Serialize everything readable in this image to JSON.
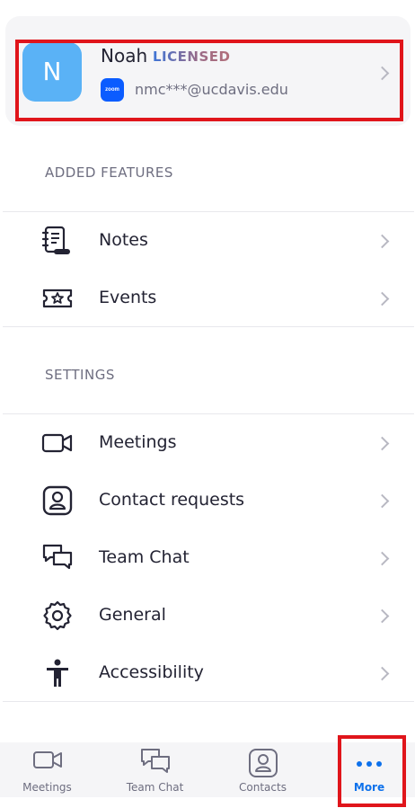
{
  "profile": {
    "avatar_initial": "N",
    "name": "Noah",
    "license": "LICENSED",
    "badge_text": "zoom",
    "email": "nmc***@ucdavis.edu"
  },
  "sections": {
    "added_features": "ADDED FEATURES",
    "settings": "SETTINGS"
  },
  "added_features": [
    {
      "label": "Notes",
      "icon": "notes-icon"
    },
    {
      "label": "Events",
      "icon": "ticket-icon"
    }
  ],
  "settings": [
    {
      "label": "Meetings",
      "icon": "video-camera-icon"
    },
    {
      "label": "Contact requests",
      "icon": "contact-icon"
    },
    {
      "label": "Team Chat",
      "icon": "chat-bubbles-icon"
    },
    {
      "label": "General",
      "icon": "gear-icon"
    },
    {
      "label": "Accessibility",
      "icon": "accessibility-icon"
    }
  ],
  "tabbar": {
    "meetings": "Meetings",
    "team_chat": "Team Chat",
    "contacts": "Contacts",
    "more": "More",
    "active_tab": "more"
  },
  "colors": {
    "accent": "#0e71eb",
    "avatar_bg": "#5ab2f6",
    "highlight": "#e0151b",
    "zoom_badge": "#0b5cff"
  }
}
